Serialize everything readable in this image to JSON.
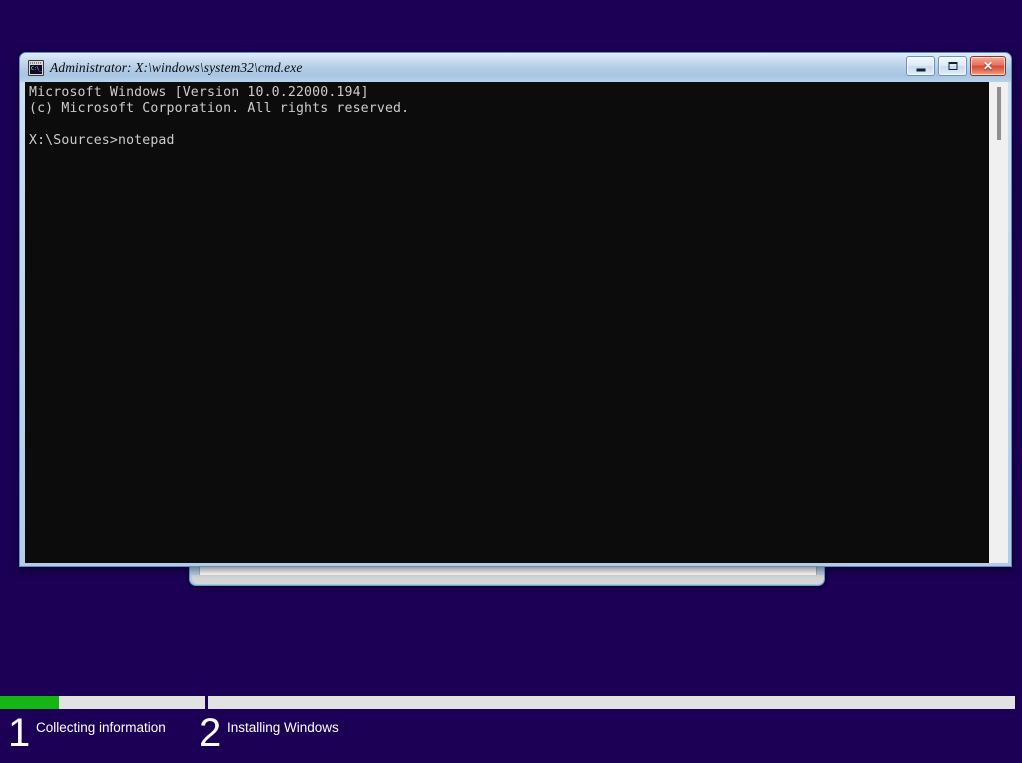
{
  "desktop": {
    "background_color": "#1b0055"
  },
  "cmd_window": {
    "title": "Administrator: X:\\windows\\system32\\cmd.exe",
    "icon_name": "cmd-icon",
    "icon_text": "C:\\_",
    "titlebar_buttons": {
      "minimize_label": "",
      "maximize_label": "",
      "close_label": "✕"
    },
    "console": {
      "lines": [
        "Microsoft Windows [Version 10.0.22000.194]",
        "(c) Microsoft Corporation. All rights reserved.",
        "",
        "X:\\Sources>notepad"
      ],
      "text": "Microsoft Windows [Version 10.0.22000.194]\n(c) Microsoft Corporation. All rights reserved.\n\nX:\\Sources>notepad",
      "foreground_color": "#cccccc",
      "background_color": "#0c0c0c"
    }
  },
  "notepad_window": {
    "name": "notepad-window"
  },
  "setup_bar": {
    "progress_color": "#16b516",
    "track_color": "#e2e2e2",
    "steps": [
      {
        "number": "1",
        "label": "Collecting information",
        "progress_percent": 29
      },
      {
        "number": "2",
        "label": "Installing Windows",
        "progress_percent": 0
      }
    ]
  }
}
